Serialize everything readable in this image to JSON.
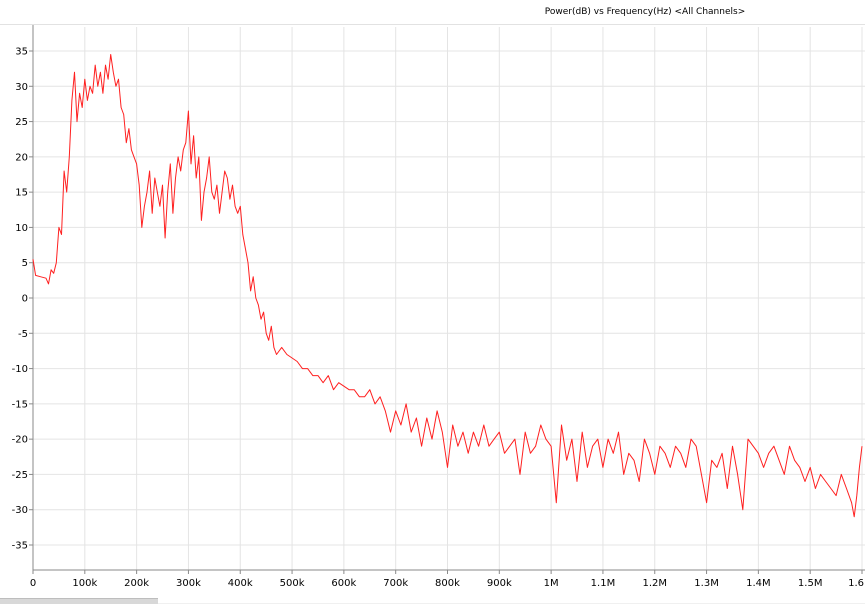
{
  "window": {
    "title": "Power(dB) vs Frequency(Hz) <All Channels>"
  },
  "colors": {
    "series": "#ff2020",
    "grid": "#e4e4e4",
    "axis": "#8a8a8a",
    "background": "#ffffff"
  },
  "chart_data": {
    "type": "line",
    "title": "Power(dB) vs Frequency(Hz) <All Channels>",
    "xlabel": "",
    "ylabel": "",
    "xlim": [
      0,
      1600000
    ],
    "ylim": [
      -40,
      38
    ],
    "grid": true,
    "x_ticks": [
      0,
      100000,
      200000,
      300000,
      400000,
      500000,
      600000,
      700000,
      800000,
      900000,
      1000000,
      1100000,
      1200000,
      1300000,
      1400000,
      1500000,
      1600000
    ],
    "x_tick_labels": [
      "0",
      "100k",
      "200k",
      "300k",
      "400k",
      "500k",
      "600k",
      "700k",
      "800k",
      "900k",
      "1M",
      "1.1M",
      "1.2M",
      "1.3M",
      "1.4M",
      "1.5M",
      "1.6"
    ],
    "y_ticks": [
      35,
      30,
      25,
      20,
      15,
      10,
      5,
      0,
      -5,
      -10,
      -15,
      -20,
      -25,
      -30,
      -35
    ],
    "y_tick_labels": [
      "35",
      "30",
      "25",
      "20",
      "15",
      "10",
      "5",
      "0",
      "-5",
      "-10",
      "-15",
      "-20",
      "-25",
      "-30",
      "-35"
    ],
    "series": [
      {
        "color": "#ff2020",
        "points": [
          [
            0,
            5.5
          ],
          [
            5000,
            3.2
          ],
          [
            15000,
            3
          ],
          [
            25000,
            2.8
          ],
          [
            30000,
            2
          ],
          [
            35000,
            4
          ],
          [
            40000,
            3.5
          ],
          [
            45000,
            5
          ],
          [
            50000,
            10
          ],
          [
            55000,
            9
          ],
          [
            60000,
            18
          ],
          [
            65000,
            15
          ],
          [
            70000,
            20
          ],
          [
            75000,
            28
          ],
          [
            80000,
            32
          ],
          [
            85000,
            25
          ],
          [
            90000,
            29
          ],
          [
            95000,
            27
          ],
          [
            100000,
            31
          ],
          [
            105000,
            28
          ],
          [
            110000,
            30
          ],
          [
            115000,
            29
          ],
          [
            120000,
            33
          ],
          [
            125000,
            30
          ],
          [
            130000,
            32
          ],
          [
            135000,
            29
          ],
          [
            140000,
            33
          ],
          [
            145000,
            31
          ],
          [
            150000,
            34.5
          ],
          [
            155000,
            32
          ],
          [
            160000,
            30
          ],
          [
            165000,
            31
          ],
          [
            170000,
            27
          ],
          [
            175000,
            26
          ],
          [
            180000,
            22
          ],
          [
            185000,
            24
          ],
          [
            190000,
            21
          ],
          [
            195000,
            20
          ],
          [
            200000,
            19
          ],
          [
            205000,
            16
          ],
          [
            210000,
            10
          ],
          [
            215000,
            13
          ],
          [
            220000,
            15
          ],
          [
            225000,
            18
          ],
          [
            230000,
            12
          ],
          [
            235000,
            17
          ],
          [
            240000,
            15
          ],
          [
            245000,
            13
          ],
          [
            250000,
            16
          ],
          [
            255000,
            8.5
          ],
          [
            260000,
            15
          ],
          [
            265000,
            19
          ],
          [
            270000,
            12
          ],
          [
            275000,
            17
          ],
          [
            280000,
            20
          ],
          [
            285000,
            18
          ],
          [
            290000,
            21
          ],
          [
            295000,
            22
          ],
          [
            300000,
            26.5
          ],
          [
            305000,
            19
          ],
          [
            310000,
            23
          ],
          [
            315000,
            17
          ],
          [
            320000,
            20
          ],
          [
            325000,
            11
          ],
          [
            330000,
            15
          ],
          [
            335000,
            17
          ],
          [
            340000,
            20
          ],
          [
            345000,
            15
          ],
          [
            350000,
            14
          ],
          [
            355000,
            16
          ],
          [
            360000,
            12
          ],
          [
            365000,
            15
          ],
          [
            370000,
            18
          ],
          [
            375000,
            17
          ],
          [
            380000,
            14
          ],
          [
            385000,
            16
          ],
          [
            390000,
            13
          ],
          [
            395000,
            12
          ],
          [
            400000,
            13
          ],
          [
            405000,
            9
          ],
          [
            410000,
            7
          ],
          [
            415000,
            5
          ],
          [
            420000,
            1
          ],
          [
            425000,
            3
          ],
          [
            430000,
            0
          ],
          [
            435000,
            -1
          ],
          [
            440000,
            -3
          ],
          [
            445000,
            -2
          ],
          [
            450000,
            -5
          ],
          [
            455000,
            -6
          ],
          [
            460000,
            -4
          ],
          [
            465000,
            -7
          ],
          [
            470000,
            -8
          ],
          [
            480000,
            -7
          ],
          [
            490000,
            -8
          ],
          [
            500000,
            -8.5
          ],
          [
            510000,
            -9
          ],
          [
            520000,
            -10
          ],
          [
            530000,
            -10
          ],
          [
            540000,
            -11
          ],
          [
            550000,
            -11
          ],
          [
            560000,
            -12
          ],
          [
            570000,
            -11
          ],
          [
            580000,
            -13
          ],
          [
            590000,
            -12
          ],
          [
            600000,
            -12.5
          ],
          [
            610000,
            -13
          ],
          [
            620000,
            -13
          ],
          [
            630000,
            -14
          ],
          [
            640000,
            -14
          ],
          [
            650000,
            -13
          ],
          [
            660000,
            -15
          ],
          [
            670000,
            -14
          ],
          [
            680000,
            -16
          ],
          [
            690000,
            -19
          ],
          [
            700000,
            -16
          ],
          [
            710000,
            -18
          ],
          [
            720000,
            -15
          ],
          [
            730000,
            -19
          ],
          [
            740000,
            -17
          ],
          [
            750000,
            -21
          ],
          [
            760000,
            -17
          ],
          [
            770000,
            -20
          ],
          [
            780000,
            -16
          ],
          [
            790000,
            -19
          ],
          [
            800000,
            -24
          ],
          [
            810000,
            -18
          ],
          [
            820000,
            -21
          ],
          [
            830000,
            -19
          ],
          [
            840000,
            -22
          ],
          [
            850000,
            -19
          ],
          [
            860000,
            -21
          ],
          [
            870000,
            -18
          ],
          [
            880000,
            -21
          ],
          [
            890000,
            -20
          ],
          [
            900000,
            -19
          ],
          [
            910000,
            -22
          ],
          [
            920000,
            -21
          ],
          [
            930000,
            -20
          ],
          [
            940000,
            -25
          ],
          [
            950000,
            -19
          ],
          [
            960000,
            -22
          ],
          [
            970000,
            -21
          ],
          [
            980000,
            -18
          ],
          [
            990000,
            -20
          ],
          [
            1000000,
            -21
          ],
          [
            1010000,
            -29
          ],
          [
            1020000,
            -18
          ],
          [
            1030000,
            -23
          ],
          [
            1040000,
            -20
          ],
          [
            1050000,
            -26
          ],
          [
            1060000,
            -19
          ],
          [
            1070000,
            -24
          ],
          [
            1080000,
            -21
          ],
          [
            1090000,
            -20
          ],
          [
            1100000,
            -24
          ],
          [
            1110000,
            -20
          ],
          [
            1120000,
            -22
          ],
          [
            1130000,
            -19
          ],
          [
            1140000,
            -25
          ],
          [
            1150000,
            -22
          ],
          [
            1160000,
            -23
          ],
          [
            1170000,
            -26
          ],
          [
            1180000,
            -20
          ],
          [
            1190000,
            -22
          ],
          [
            1200000,
            -25
          ],
          [
            1210000,
            -21
          ],
          [
            1220000,
            -22
          ],
          [
            1230000,
            -24
          ],
          [
            1240000,
            -21
          ],
          [
            1250000,
            -22
          ],
          [
            1260000,
            -24
          ],
          [
            1270000,
            -20
          ],
          [
            1280000,
            -21
          ],
          [
            1290000,
            -25
          ],
          [
            1300000,
            -29
          ],
          [
            1310000,
            -23
          ],
          [
            1320000,
            -24
          ],
          [
            1330000,
            -22
          ],
          [
            1340000,
            -27
          ],
          [
            1350000,
            -21
          ],
          [
            1360000,
            -25
          ],
          [
            1370000,
            -30
          ],
          [
            1380000,
            -20
          ],
          [
            1390000,
            -21
          ],
          [
            1400000,
            -22
          ],
          [
            1410000,
            -24
          ],
          [
            1420000,
            -22
          ],
          [
            1430000,
            -21
          ],
          [
            1440000,
            -23
          ],
          [
            1450000,
            -25
          ],
          [
            1460000,
            -21
          ],
          [
            1470000,
            -23
          ],
          [
            1480000,
            -24
          ],
          [
            1490000,
            -26
          ],
          [
            1500000,
            -24
          ],
          [
            1510000,
            -27
          ],
          [
            1520000,
            -25
          ],
          [
            1530000,
            -26
          ],
          [
            1540000,
            -27
          ],
          [
            1550000,
            -28
          ],
          [
            1560000,
            -25
          ],
          [
            1570000,
            -27
          ],
          [
            1580000,
            -29
          ],
          [
            1585000,
            -31
          ],
          [
            1590000,
            -28
          ],
          [
            1595000,
            -24
          ],
          [
            1600000,
            -21
          ]
        ]
      }
    ]
  }
}
